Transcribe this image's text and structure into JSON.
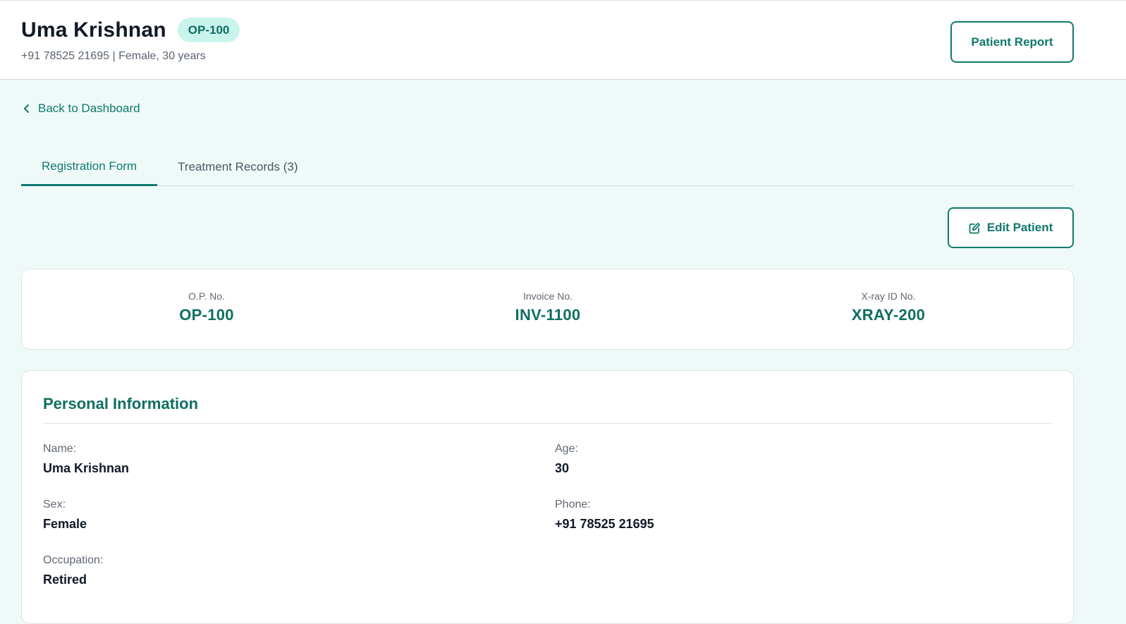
{
  "header": {
    "patient_name": "Uma Krishnan",
    "op_badge": "OP-100",
    "subtitle": "+91 78525 21695 | Female, 30 years",
    "report_button": "Patient Report"
  },
  "nav": {
    "back_label": "Back to Dashboard"
  },
  "tabs": [
    {
      "label": "Registration Form",
      "active": true
    },
    {
      "label": "Treatment Records (3)",
      "active": false
    }
  ],
  "actions": {
    "edit_label": "Edit Patient"
  },
  "identifiers": [
    {
      "label": "O.P. No.",
      "value": "OP-100"
    },
    {
      "label": "Invoice No.",
      "value": "INV-1100"
    },
    {
      "label": "X-ray ID No.",
      "value": "XRAY-200"
    }
  ],
  "personal_info": {
    "title": "Personal Information",
    "fields": [
      {
        "label": "Name:",
        "value": "Uma Krishnan"
      },
      {
        "label": "Age:",
        "value": "30"
      },
      {
        "label": "Sex:",
        "value": "Female"
      },
      {
        "label": "Phone:",
        "value": "+91 78525 21695"
      },
      {
        "label": "Occupation:",
        "value": "Retired"
      }
    ]
  },
  "colors": {
    "accent": "#0f7a6c",
    "badge_bg": "#c9f4ec",
    "page_bg": "#effaf8"
  },
  "icons": {
    "back": "chevron-left-icon",
    "edit": "edit-icon"
  }
}
